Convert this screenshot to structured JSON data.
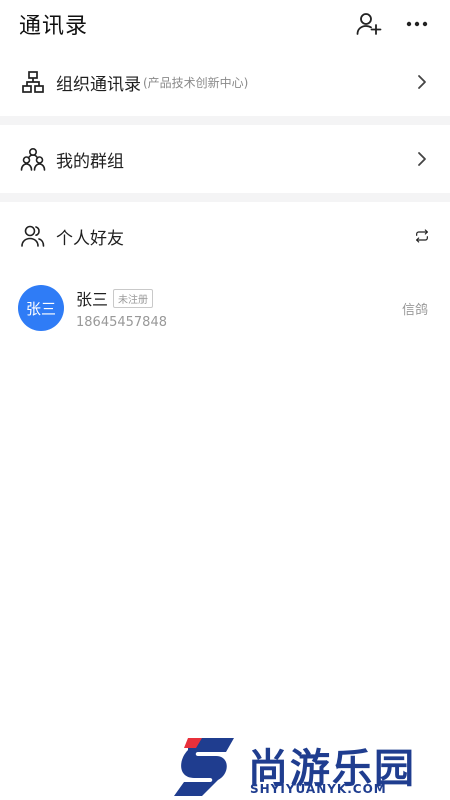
{
  "header": {
    "title": "通讯录",
    "add_contact_icon": "person-add-icon",
    "more_icon": "more-horizontal-icon"
  },
  "menu": {
    "org": {
      "label": "组织通讯录",
      "sub": "(产品技术创新中心)",
      "icon": "org-chart-icon"
    },
    "groups": {
      "label": "我的群组",
      "icon": "group-icon"
    },
    "friends": {
      "label": "个人好友",
      "icon": "people-icon"
    }
  },
  "contacts": [
    {
      "avatar_text": "张三",
      "name": "张三",
      "badge": "未注册",
      "phone": "18645457848",
      "source": "信鸽"
    }
  ],
  "watermark": {
    "brand": "尚游乐园",
    "url": "SHYIYUANYK.COM"
  },
  "colors": {
    "accent": "#2f7cf6",
    "divider": "#f4f4f5",
    "muted": "#999999"
  }
}
